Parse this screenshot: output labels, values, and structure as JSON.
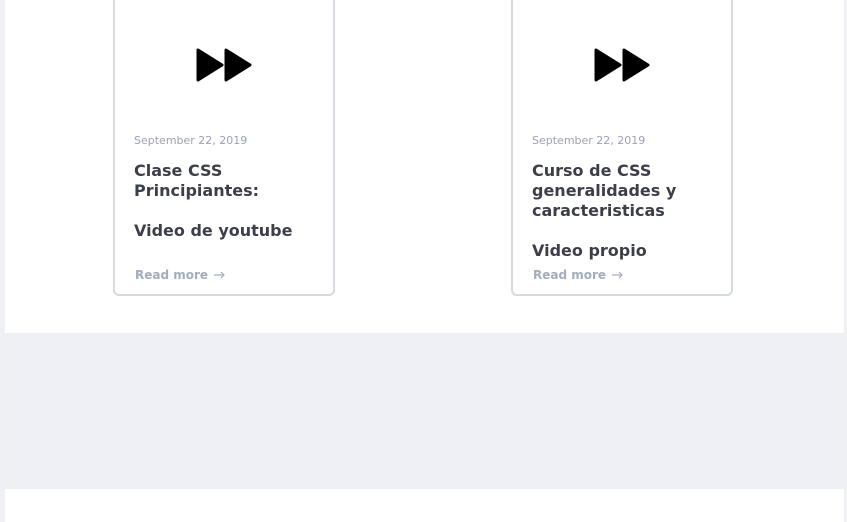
{
  "cards": [
    {
      "icon": "fast-forward-icon",
      "date": "September 22, 2019",
      "title": "Clase CSS Principiantes:",
      "subtitle": "Video de youtube",
      "read_more": "Read more",
      "read_more_icon": "arrow-right-icon"
    },
    {
      "icon": "fast-forward-icon",
      "date": "September 22, 2019",
      "title": "Curso de CSS generalidades y caracteristicas",
      "subtitle": "Video propio",
      "read_more": "Read more",
      "read_more_icon": "arrow-right-icon"
    }
  ],
  "colors": {
    "card_border": "#d4d9e2",
    "date_text": "#9aa3b3",
    "title_text": "#3c3f4a",
    "read_more_text": "#a3acbb",
    "band_background": "#eef0f5",
    "icon_fill": "#000000"
  }
}
